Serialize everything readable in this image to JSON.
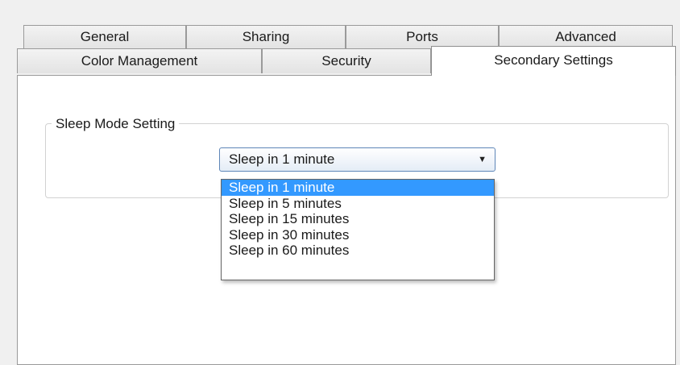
{
  "tabs_row1": [
    "General",
    "Sharing",
    "Ports",
    "Advanced"
  ],
  "tabs_row2": [
    "Color Management",
    "Security",
    "Secondary Settings"
  ],
  "selected_tab": "Secondary Settings",
  "group": {
    "label": "Sleep Mode Setting"
  },
  "sleep_select": {
    "value": "Sleep in 1 minute",
    "options": [
      "Sleep in 1 minute",
      "Sleep in 5 minutes",
      "Sleep in 15 minutes",
      "Sleep in 30 minutes",
      "Sleep in 60 minutes"
    ],
    "highlighted": "Sleep in 1 minute"
  },
  "icons": {
    "dropdown_arrow": "chevron-down-icon"
  },
  "colors": {
    "selection": "#3399ff",
    "combo_border": "#5e86b8"
  }
}
